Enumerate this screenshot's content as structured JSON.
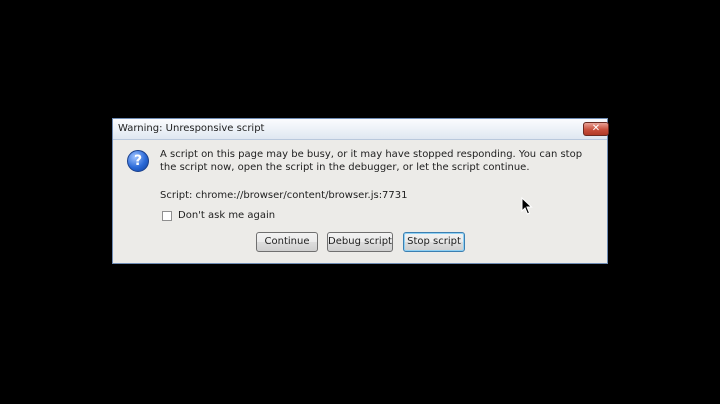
{
  "dialog": {
    "title": "Warning: Unresponsive script",
    "close_label": "✕",
    "icon": "question-icon",
    "message": "A script on this page may be busy, or it may have stopped responding. You can stop the script now, open the script in the debugger, or let the script continue.",
    "script_line": "Script: chrome://browser/content/browser.js:7731",
    "checkbox_label": "Don't ask me again",
    "checkbox_checked": false,
    "buttons": {
      "continue": "Continue",
      "debug": "Debug script",
      "stop": "Stop script"
    }
  },
  "colors": {
    "background": "#000000",
    "dialog_bg": "#ecebe8",
    "title_gradient_top": "#fbfcfe",
    "close_red": "#c9503d",
    "default_button_border": "#3c7fb1"
  }
}
